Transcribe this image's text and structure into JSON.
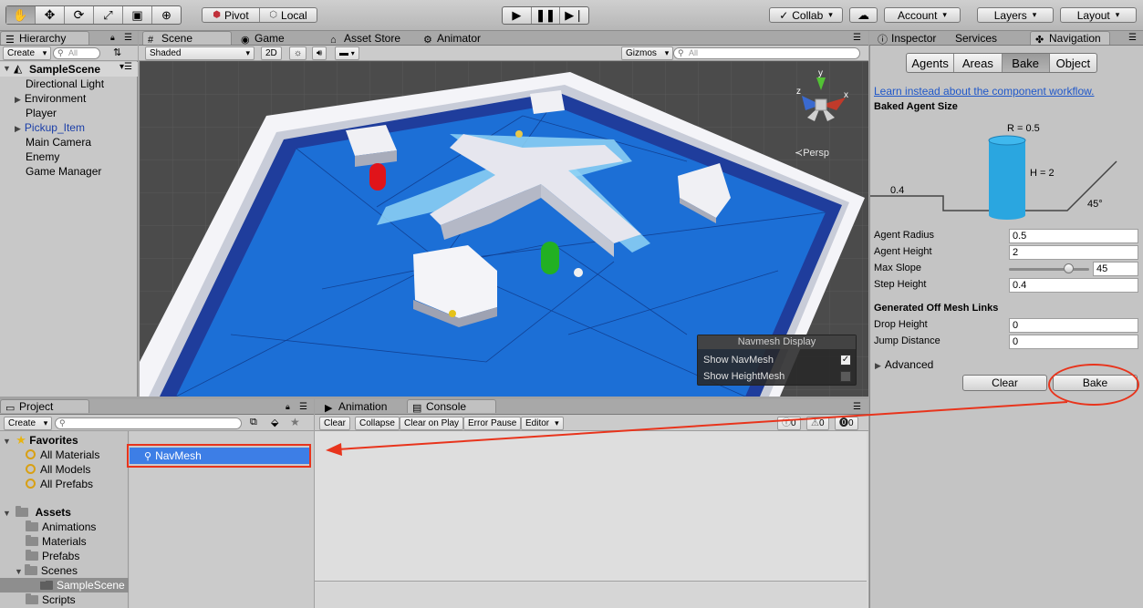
{
  "toolbar": {
    "tools": [
      "hand-tool",
      "move-tool",
      "rotate-tool",
      "scale-tool",
      "rect-tool",
      "transform-tool"
    ],
    "pivot": "Pivot",
    "local": "Local",
    "collab": "Collab",
    "account": "Account",
    "layers": "Layers",
    "layout": "Layout"
  },
  "hierarchy": {
    "tab": "Hierarchy",
    "create": "Create",
    "search_placeholder": "All",
    "scene": "SampleScene",
    "items": [
      "Directional Light",
      "Environment",
      "Player",
      "Pickup_Item",
      "Main Camera",
      "Enemy",
      "Game Manager"
    ]
  },
  "scene_tabs": [
    "Scene",
    "Game",
    "Asset Store",
    "Animator"
  ],
  "scene_toolbar": {
    "shading": "Shaded",
    "mode_2d": "2D",
    "gizmos": "Gizmos",
    "search_placeholder": "All"
  },
  "gizmo": {
    "persp": "Persp",
    "x": "x",
    "y": "y",
    "z": "z"
  },
  "navmesh_display": {
    "title": "Navmesh Display",
    "show_navmesh": "Show NavMesh",
    "show_heightmesh": "Show HeightMesh",
    "show_navmesh_checked": true,
    "show_heightmesh_checked": false
  },
  "inspector": {
    "tabs": [
      "Inspector",
      "Services",
      "Navigation"
    ],
    "nav_tabs": [
      "Agents",
      "Areas",
      "Bake",
      "Object"
    ],
    "link": "Learn instead about the component workflow.",
    "baked_agent_size": "Baked Agent Size",
    "diagram": {
      "radius": "R = 0.5",
      "height": "H = 2",
      "step": "0.4",
      "slope": "45°"
    },
    "fields": [
      {
        "label": "Agent Radius",
        "value": "0.5"
      },
      {
        "label": "Agent Height",
        "value": "2"
      },
      {
        "label": "Max Slope",
        "value": "45"
      },
      {
        "label": "Step Height",
        "value": "0.4"
      }
    ],
    "max_slope_fraction": 0.75,
    "offmesh_title": "Generated Off Mesh Links",
    "offmesh_fields": [
      {
        "label": "Drop Height",
        "value": "0"
      },
      {
        "label": "Jump Distance",
        "value": "0"
      }
    ],
    "advanced": "Advanced",
    "clear": "Clear",
    "bake": "Bake"
  },
  "project": {
    "tab": "Project",
    "create": "Create",
    "favorites": "Favorites",
    "favorite_items": [
      "All Materials",
      "All Models",
      "All Prefabs"
    ],
    "assets": "Assets",
    "asset_items": [
      "Animations",
      "Materials",
      "Prefabs",
      "Scenes",
      "SampleScene",
      "Scripts"
    ],
    "selected_asset": "NavMesh"
  },
  "console": {
    "tabs": [
      "Animation",
      "Console"
    ],
    "buttons": [
      "Clear",
      "Collapse",
      "Clear on Play",
      "Error Pause",
      "Editor"
    ],
    "counts": [
      "0",
      "0",
      "0"
    ]
  },
  "colors": {
    "accent_select": "#3d7ee6",
    "annotation": "#e8341c",
    "navmesh": "#1c6fd6",
    "link": "#1f57c9"
  }
}
